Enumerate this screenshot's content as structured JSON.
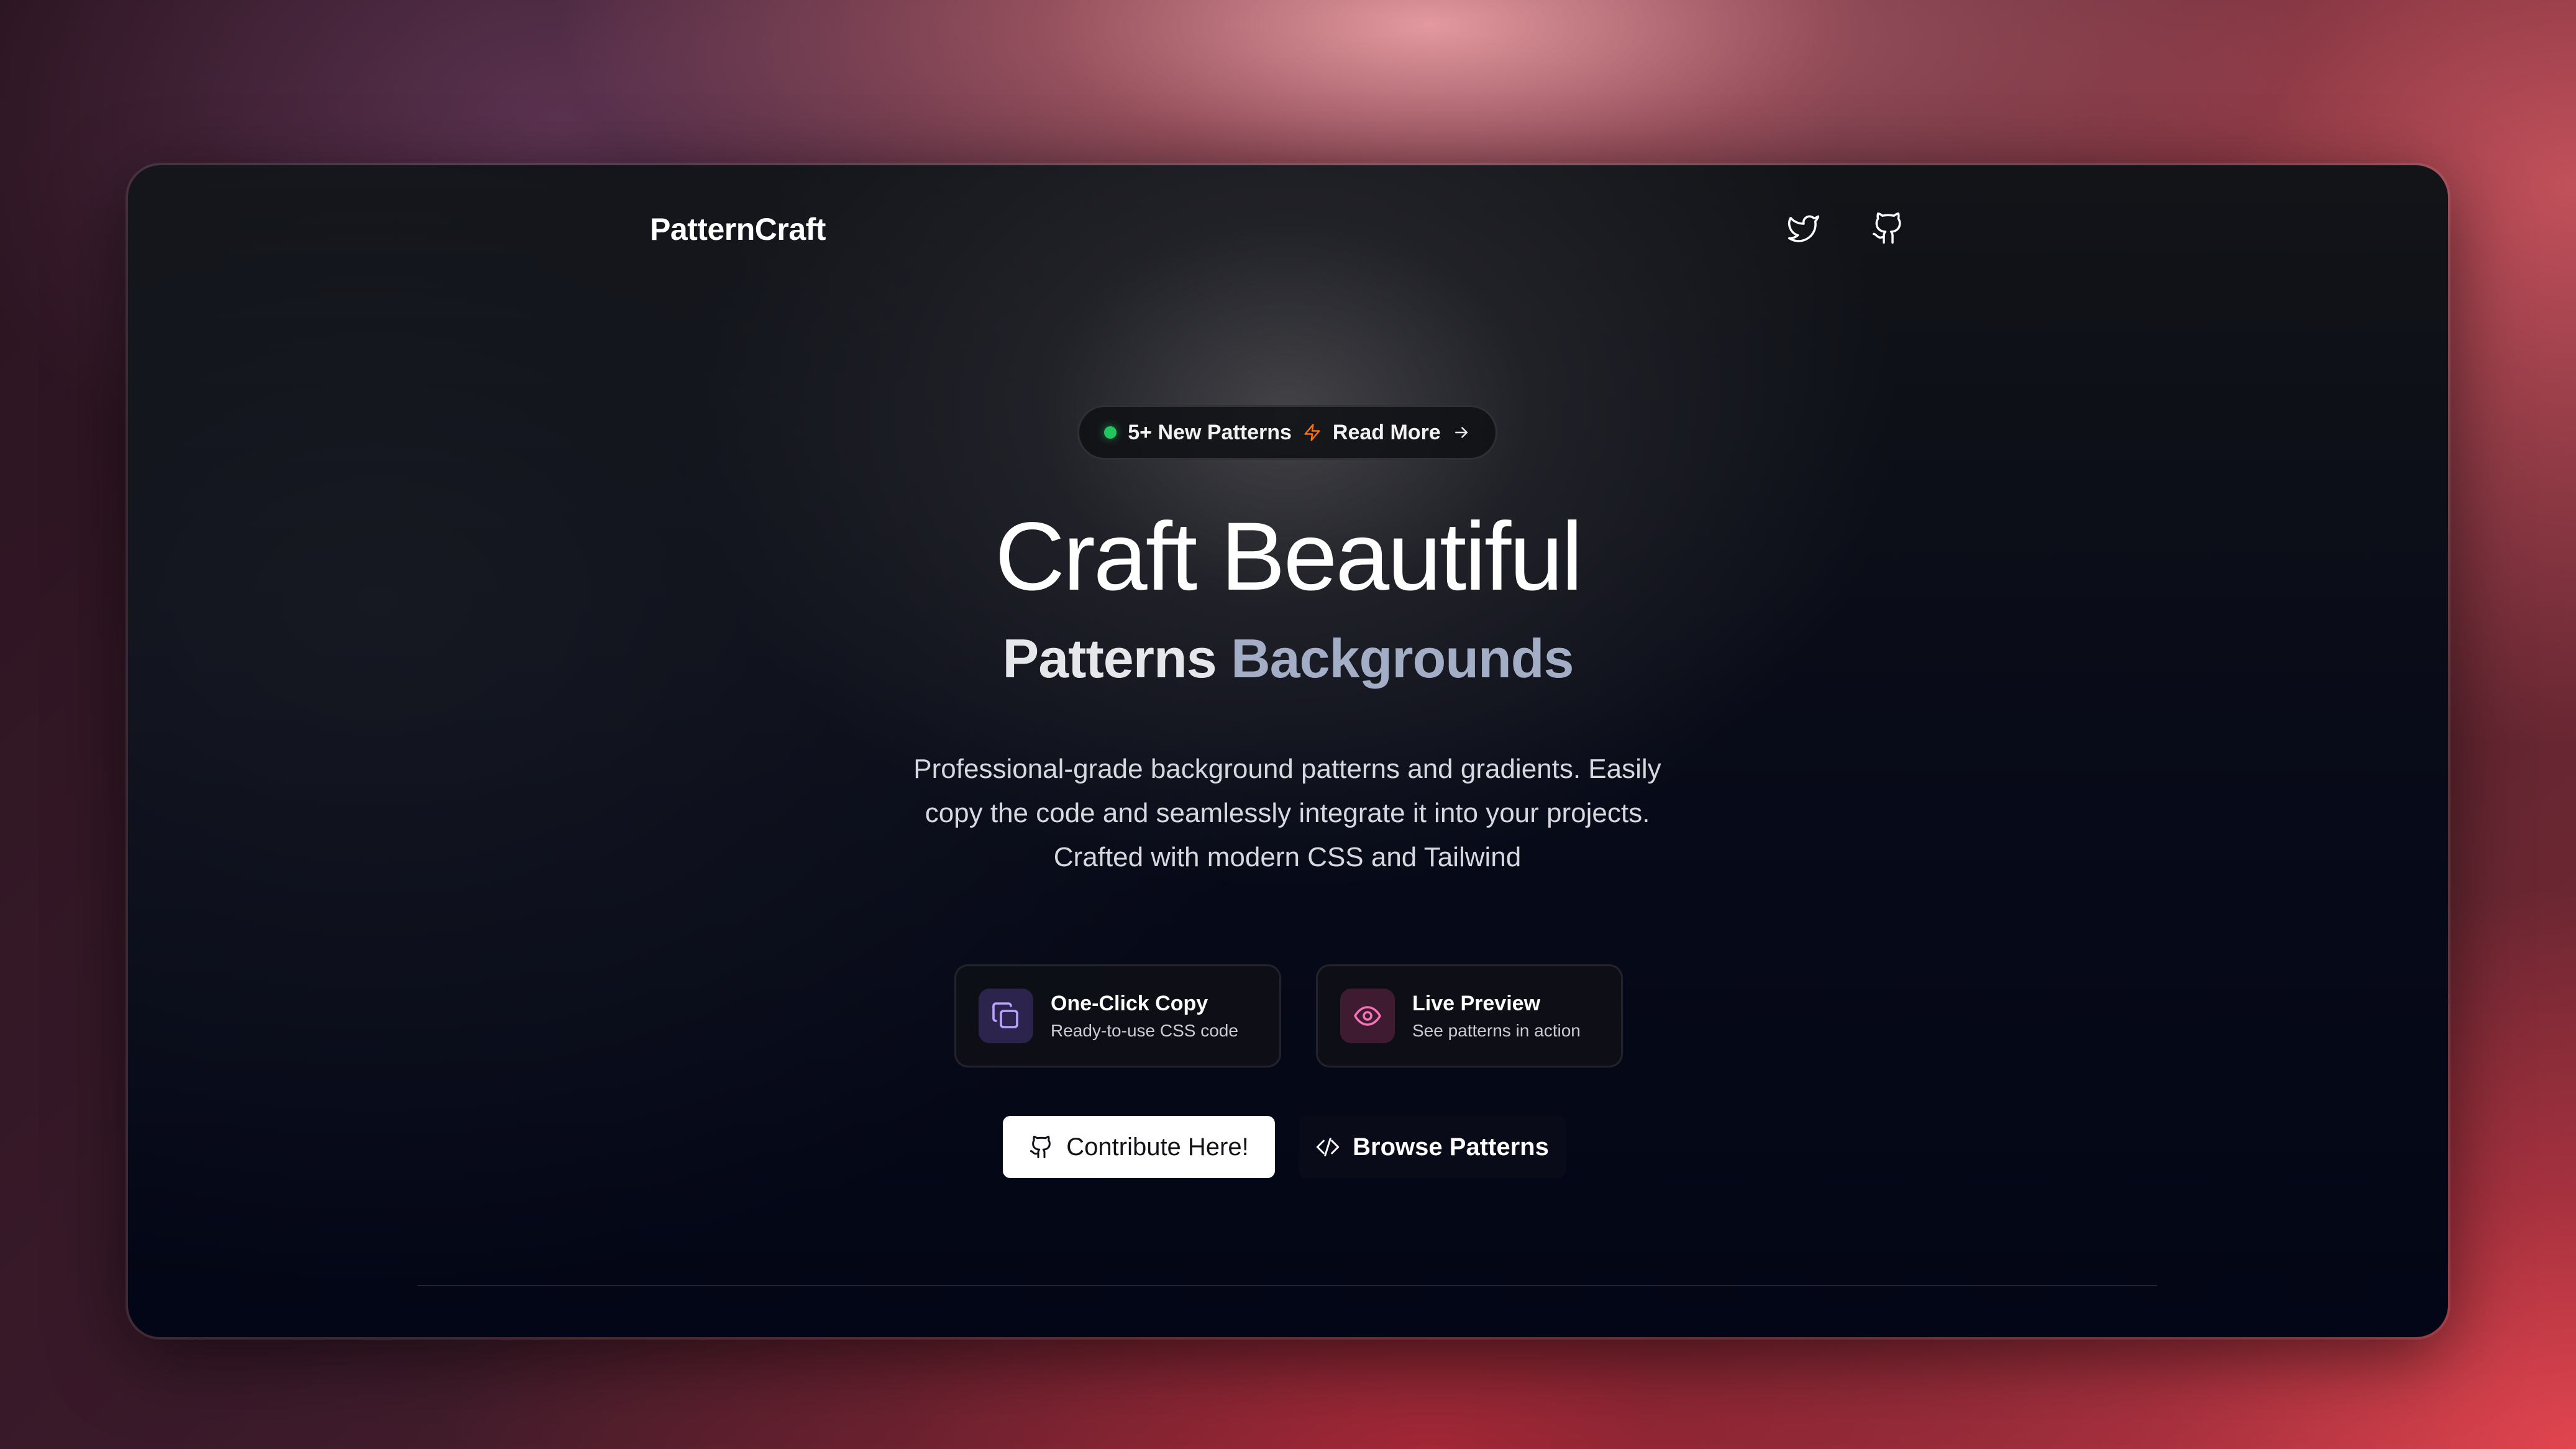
{
  "app": {
    "logo": "PatternCraft"
  },
  "nav": {
    "twitter_icon": "twitter-icon",
    "github_icon": "github-icon"
  },
  "announcement": {
    "status_color": "#22c55e",
    "text": "5+ New Patterns",
    "separator_icon": "lightning-icon",
    "link_label": "Read More",
    "link_icon": "arrow-right-icon"
  },
  "hero": {
    "title": "Craft Beautiful",
    "subtitle_primary": "Patterns",
    "subtitle_accent": "Backgrounds",
    "description_lines": [
      "Professional-grade background patterns and gradients. Easily",
      "copy the code and seamlessly integrate it into your projects.",
      "Crafted with modern CSS and Tailwind"
    ]
  },
  "features": [
    {
      "icon": "copy-icon",
      "title": "One-Click Copy",
      "subtitle": "Ready-to-use CSS code",
      "accent": "#a78bfa"
    },
    {
      "icon": "eye-icon",
      "title": "Live Preview",
      "subtitle": "See patterns in action",
      "accent": "#f472b6"
    }
  ],
  "actions": {
    "contribute_label": "Contribute Here!",
    "contribute_icon": "github-icon",
    "browse_label": "Browse Patterns",
    "browse_icon": "code-icon"
  },
  "colors": {
    "badge_dot": "#22c55e",
    "lightning": "#f97316",
    "subtitle_accent": "#a3adc6"
  }
}
